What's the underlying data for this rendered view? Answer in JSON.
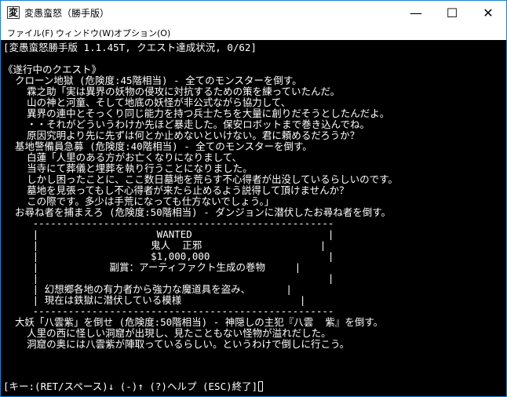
{
  "window": {
    "title": "変愚蛮怒（勝手版）",
    "app_icon_glyph": "変",
    "minimize_glyph": "—",
    "maximize_glyph": "☐",
    "close_glyph": "✕"
  },
  "menu": {
    "items": [
      "ファイル(F)",
      "ウィンドウ(W)",
      "オプション(O)"
    ]
  },
  "terminal": {
    "lines": [
      "[変愚蛮怒勝手版 1.1.45T, クエスト達成状況, 0/62]",
      "",
      "《遂行中のクエスト》",
      "  クローン地獄 (危険度:45階相当) - 全てのモンスターを倒す。",
      "    霖之助「実は異界の妖物の侵攻に対抗するための策を練っていたんだ。",
      "    山の神と河童、そして地底の妖怪が非公式ながら協力して、",
      "    異界の連中とそっくり同じ能力を持つ兵士たちを大量に創りだそうとしたんだよ。",
      "    ・・それがどういうわけか先ほど暴走した。保安ロボットまで巻き込んでね。",
      "    原因究明より先に先ずは何とか止めないといけない。君に頼めるだろうか？",
      "  基地警備員急募 (危険度:40階相当) - 全てのモンスターを倒す。",
      "    白蓮「人里のある方がお亡くなりになりまして、",
      "    当寺にて葬儀と埋葬を執り行うことになりました。",
      "    しかし困ったことに、ここ数日墓地を荒らす不心得者が出没しているらしいのです。",
      "    墓地を見張ってもし不心得者が来たら止めるよう説得して頂けませんか？",
      "    この際です。多少は手荒になっても仕方ないでしょう。」",
      "  お尋ね者を捕まえろ (危険度:50階相当) - ダンジョンに潜伏したお尋ね者を倒す。",
      "     ---------------------------------------------------",
      "     |                    WANTED                       |",
      "     |                   鬼人  正邪                    |",
      "     |                   $1,000,000                    |",
      "     |            副賞：アーティファクト生成の巻物     |",
      "     |                                                 |",
      "     | 幻想郷各地の有力者から強力な魔道具を盗み、      |",
      "     | 現在は鉄獄に潜伏している模様                    |",
      "     ---------------------------------------------------",
      "  大妖「八雲紫」を倒せ (危険度:50階相当) - 神隠しの主犯『八雲  紫』を倒す。",
      "    人里の西に怪しい洞窟が出現し、見たこともない怪物が溢れだした。",
      "    洞窟の奥には八雲紫が陣取っているらしい。というわけで倒しに行こう。",
      "",
      "",
      "[キー:(RET/スペース)↓ (-)↑ (?)ヘルプ (ESC)終了]"
    ]
  }
}
